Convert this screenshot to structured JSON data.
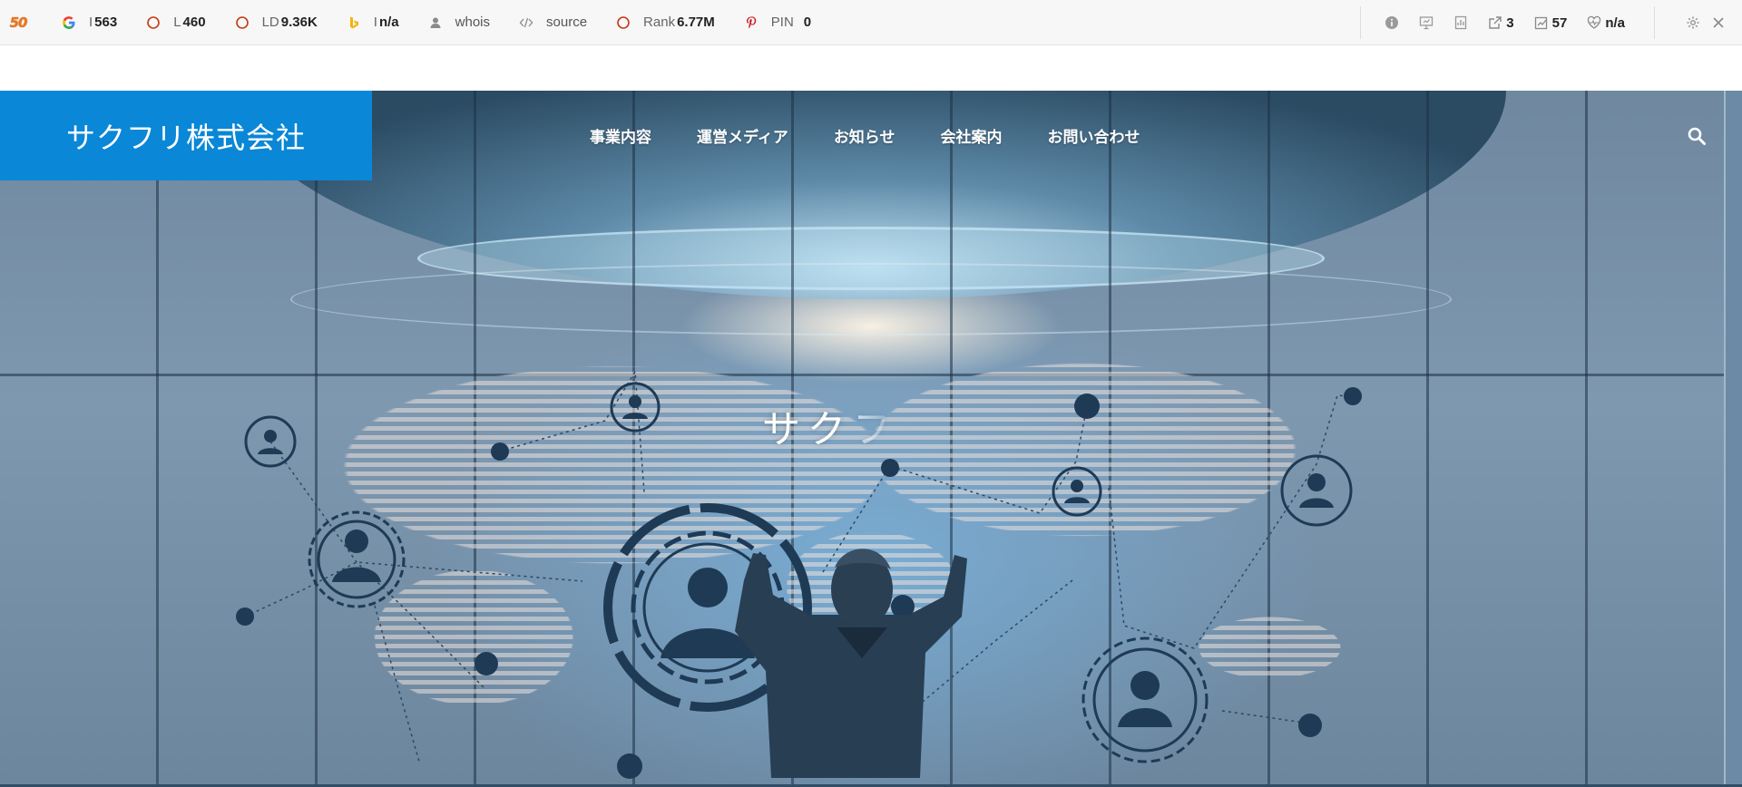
{
  "seo_toolbar": {
    "logo_text": "50",
    "metrics": [
      {
        "id": "google-index",
        "icon": "google-icon",
        "label": "I",
        "value": "563"
      },
      {
        "id": "links",
        "icon": "circle-icon",
        "label": "L",
        "value": "460"
      },
      {
        "id": "linking-domains",
        "icon": "circle-icon",
        "label": "LD",
        "value": "9.36K"
      },
      {
        "id": "bing-index",
        "icon": "bing-icon",
        "label": "I",
        "value": "n/a"
      },
      {
        "id": "whois",
        "icon": "person-icon",
        "label": "whois",
        "value": ""
      },
      {
        "id": "source",
        "icon": "code-icon",
        "label": "source",
        "value": ""
      },
      {
        "id": "rank",
        "icon": "circle-icon",
        "label": "Rank",
        "value": "6.77M"
      },
      {
        "id": "pinterest",
        "icon": "pinterest-icon",
        "label": "PIN",
        "value": "0"
      }
    ],
    "right_items": [
      {
        "icon": "info-icon",
        "value": ""
      },
      {
        "icon": "presentation-icon",
        "value": ""
      },
      {
        "icon": "bookmark-chart-icon",
        "value": ""
      },
      {
        "icon": "external-link-icon",
        "value": "3"
      },
      {
        "icon": "edit-chart-icon",
        "value": "57"
      },
      {
        "icon": "heartbeat-icon",
        "value": "n/a"
      }
    ],
    "controls": [
      "gear-icon",
      "close-icon"
    ]
  },
  "site": {
    "logo": "サクフリ株式会社",
    "nav": [
      "事業内容",
      "運営メディア",
      "お知らせ",
      "会社案内",
      "お問い合わせ"
    ],
    "search_icon": "search-icon",
    "hero_tagline": "サクフ"
  },
  "colors": {
    "brand_blue": "#0a87d6",
    "toolbar_bg": "#f7f7f7",
    "accent_red": "#c23a12",
    "bing_yellow": "#f2b50f",
    "pinterest_red": "#cb1f27"
  }
}
